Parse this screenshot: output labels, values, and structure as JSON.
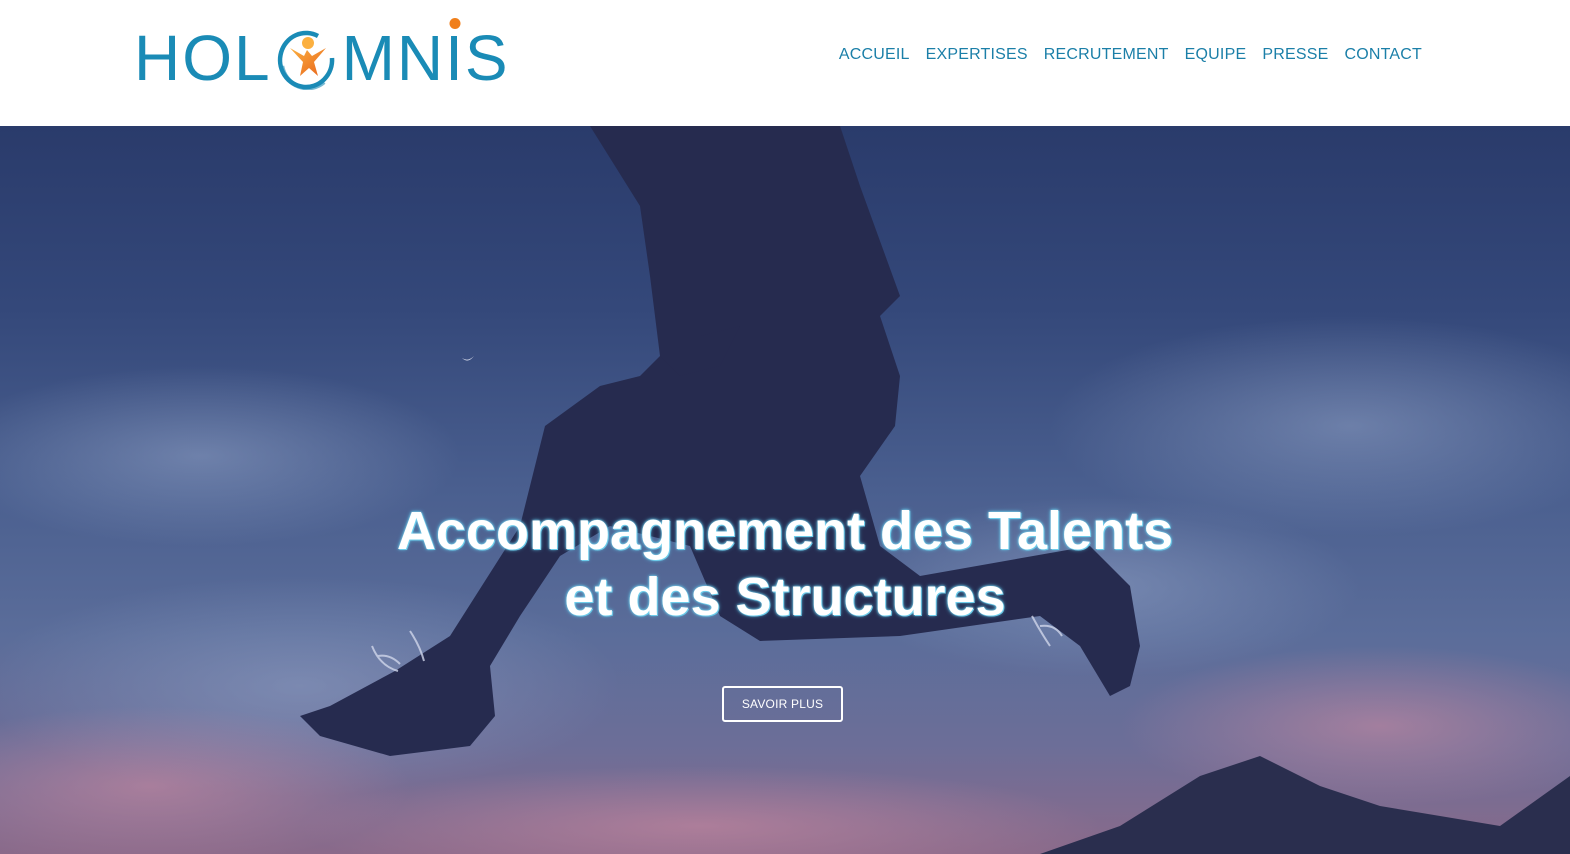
{
  "brand": {
    "logo_text_left": "HOL",
    "logo_text_right_a": "MN",
    "logo_text_right_b": "S",
    "colors": {
      "primary": "#1a8bb6",
      "accent": "#f07f1b",
      "nav": "#1b7fa8"
    },
    "logo_icon": "person-in-circle-icon"
  },
  "nav": {
    "items": [
      {
        "label": "ACCUEIL"
      },
      {
        "label": "EXPERTISES"
      },
      {
        "label": "RECRUTEMENT"
      },
      {
        "label": "EQUIPE"
      },
      {
        "label": "PRESSE"
      },
      {
        "label": "CONTACT"
      }
    ]
  },
  "hero": {
    "title_line1": "Accompagnement des Talents",
    "title_line2": "et des Structures",
    "button_label": "SAVOIR PLUS",
    "background": "jumping-person-silhouette-at-dusk-image"
  }
}
